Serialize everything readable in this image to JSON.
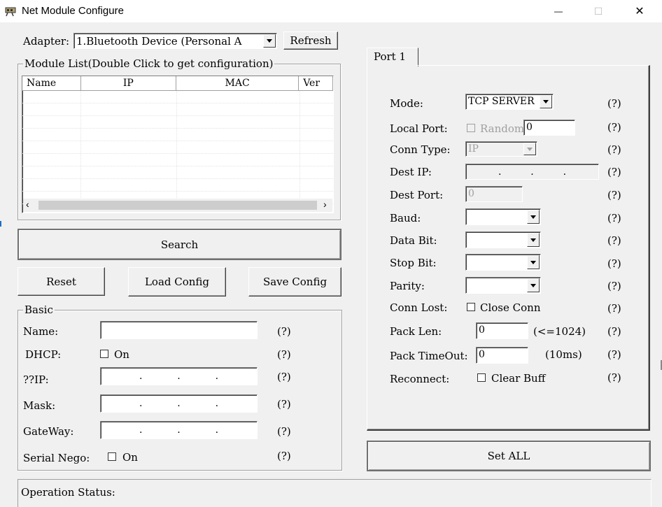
{
  "window": {
    "title": "Net Module Configure",
    "controls": {
      "minimize": "—",
      "maximize": "☐",
      "close": "✕"
    }
  },
  "adapter": {
    "label": "Adapter:",
    "selected": "1.Bluetooth Device (Personal A",
    "refresh_label": "Refresh"
  },
  "module_list": {
    "legend": "Module List(Double Click to get configuration)",
    "columns": [
      "Name",
      "IP",
      "MAC",
      "Ver"
    ]
  },
  "actions": {
    "search": "Search",
    "reset": "Reset",
    "load_config": "Load Config",
    "save_config": "Save Config",
    "set_all": "Set ALL"
  },
  "basic": {
    "legend": "Basic",
    "name_label": "Name:",
    "dhcp_label": "DHCP:",
    "dhcp_on": "On",
    "ip_label": "??IP:",
    "mask_label": "Mask:",
    "gateway_label": "GateWay:",
    "serial_nego_label": "Serial Nego:",
    "serial_nego_on": "On",
    "help": "(?)"
  },
  "port": {
    "tab": "Port 1",
    "mode_label": "Mode:",
    "mode_value": "TCP SERVER",
    "local_port_label": "Local Port:",
    "random_label": "Random",
    "local_port_value": "0",
    "conn_type_label": "Conn Type:",
    "conn_type_value": "IP",
    "dest_ip_label": "Dest IP:",
    "dest_port_label": "Dest Port:",
    "dest_port_value": "0",
    "baud_label": "Baud:",
    "data_bit_label": "Data Bit:",
    "stop_bit_label": "Stop Bit:",
    "parity_label": "Parity:",
    "conn_lost_label": "Conn Lost:",
    "close_conn_label": "Close Conn",
    "pack_len_label": "Pack Len:",
    "pack_len_value": "0",
    "pack_len_hint": "(<=1024)",
    "pack_timeout_label": "Pack TimeOut:",
    "pack_timeout_value": "0",
    "pack_timeout_hint": "(10ms)",
    "reconnect_label": "Reconnect:",
    "clear_buff_label": "Clear Buff",
    "help": "(?)"
  },
  "status": {
    "label": "Operation Status:"
  }
}
